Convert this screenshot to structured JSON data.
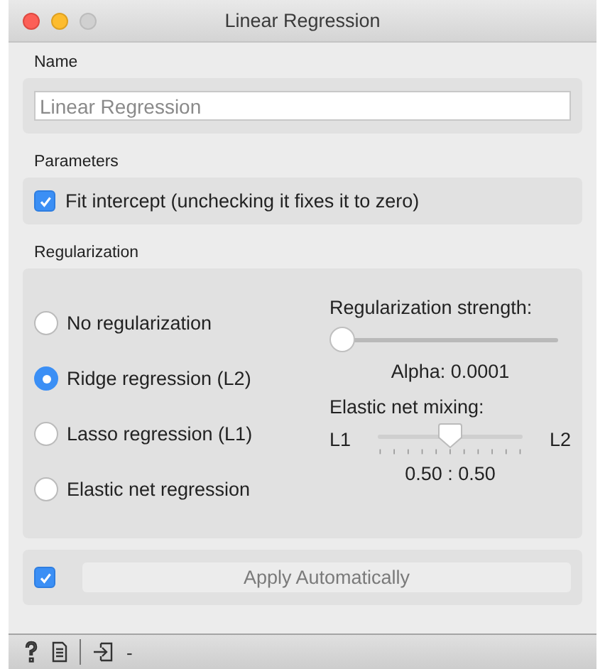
{
  "window": {
    "title": "Linear Regression"
  },
  "name_section": {
    "label": "Name",
    "field": {
      "placeholder": "Linear Regression"
    }
  },
  "parameters": {
    "label": "Parameters",
    "fit_intercept": {
      "label": "Fit intercept (unchecking it fixes it to zero)",
      "checked": true
    }
  },
  "regularization": {
    "label": "Regularization",
    "options": [
      {
        "label": "No regularization",
        "selected": false
      },
      {
        "label": "Ridge regression (L2)",
        "selected": true
      },
      {
        "label": "Lasso regression (L1)",
        "selected": false
      },
      {
        "label": "Elastic net regression",
        "selected": false
      }
    ],
    "strength": {
      "label": "Regularization strength:",
      "level": 0,
      "reading": "Alpha: 0.0001"
    },
    "mixing": {
      "label": "Elastic net mixing:",
      "left": "L1",
      "right": "L2",
      "level": 0.5,
      "reading": "0.50 : 0.50"
    }
  },
  "apply": {
    "auto_checked": true,
    "button": {
      "label": "Apply Automatically",
      "disabled": true
    }
  },
  "status_bar": {
    "text": "-"
  }
}
